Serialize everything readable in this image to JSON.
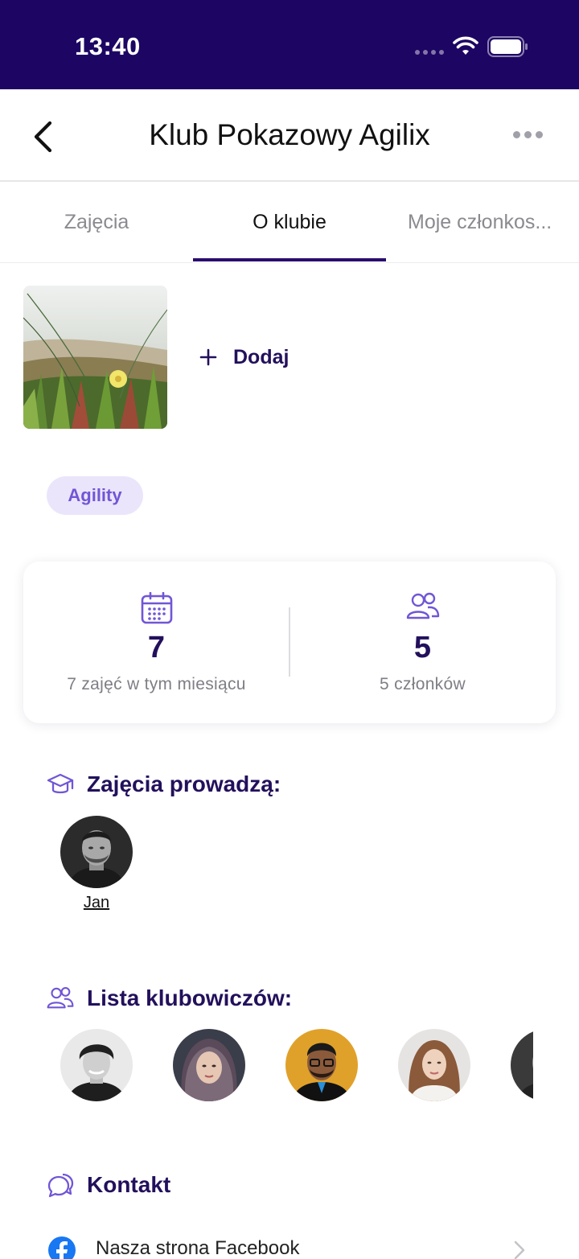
{
  "status_bar": {
    "time": "13:40"
  },
  "nav": {
    "title": "Klub Pokazowy Agilix"
  },
  "tabs": [
    {
      "label": "Zajęcia"
    },
    {
      "label": "O klubie"
    },
    {
      "label": "Moje członkos..."
    }
  ],
  "gallery": {
    "add_label": "Dodaj"
  },
  "tags": [
    "Agility"
  ],
  "stats": {
    "classes": {
      "value": "7",
      "label": "7 zajęć w tym miesiącu"
    },
    "members": {
      "value": "5",
      "label": "5 członków"
    }
  },
  "instructors": {
    "title": "Zajęcia prowadzą:",
    "items": [
      {
        "name": "Jan"
      }
    ]
  },
  "members": {
    "title": "Lista klubowiczów:"
  },
  "contact": {
    "title": "Kontakt",
    "items": [
      {
        "label": "Nasza strona Facebook"
      }
    ]
  },
  "colors": {
    "brand_dark": "#1d0563",
    "accent": "#7156d6",
    "heading": "#23105c"
  }
}
